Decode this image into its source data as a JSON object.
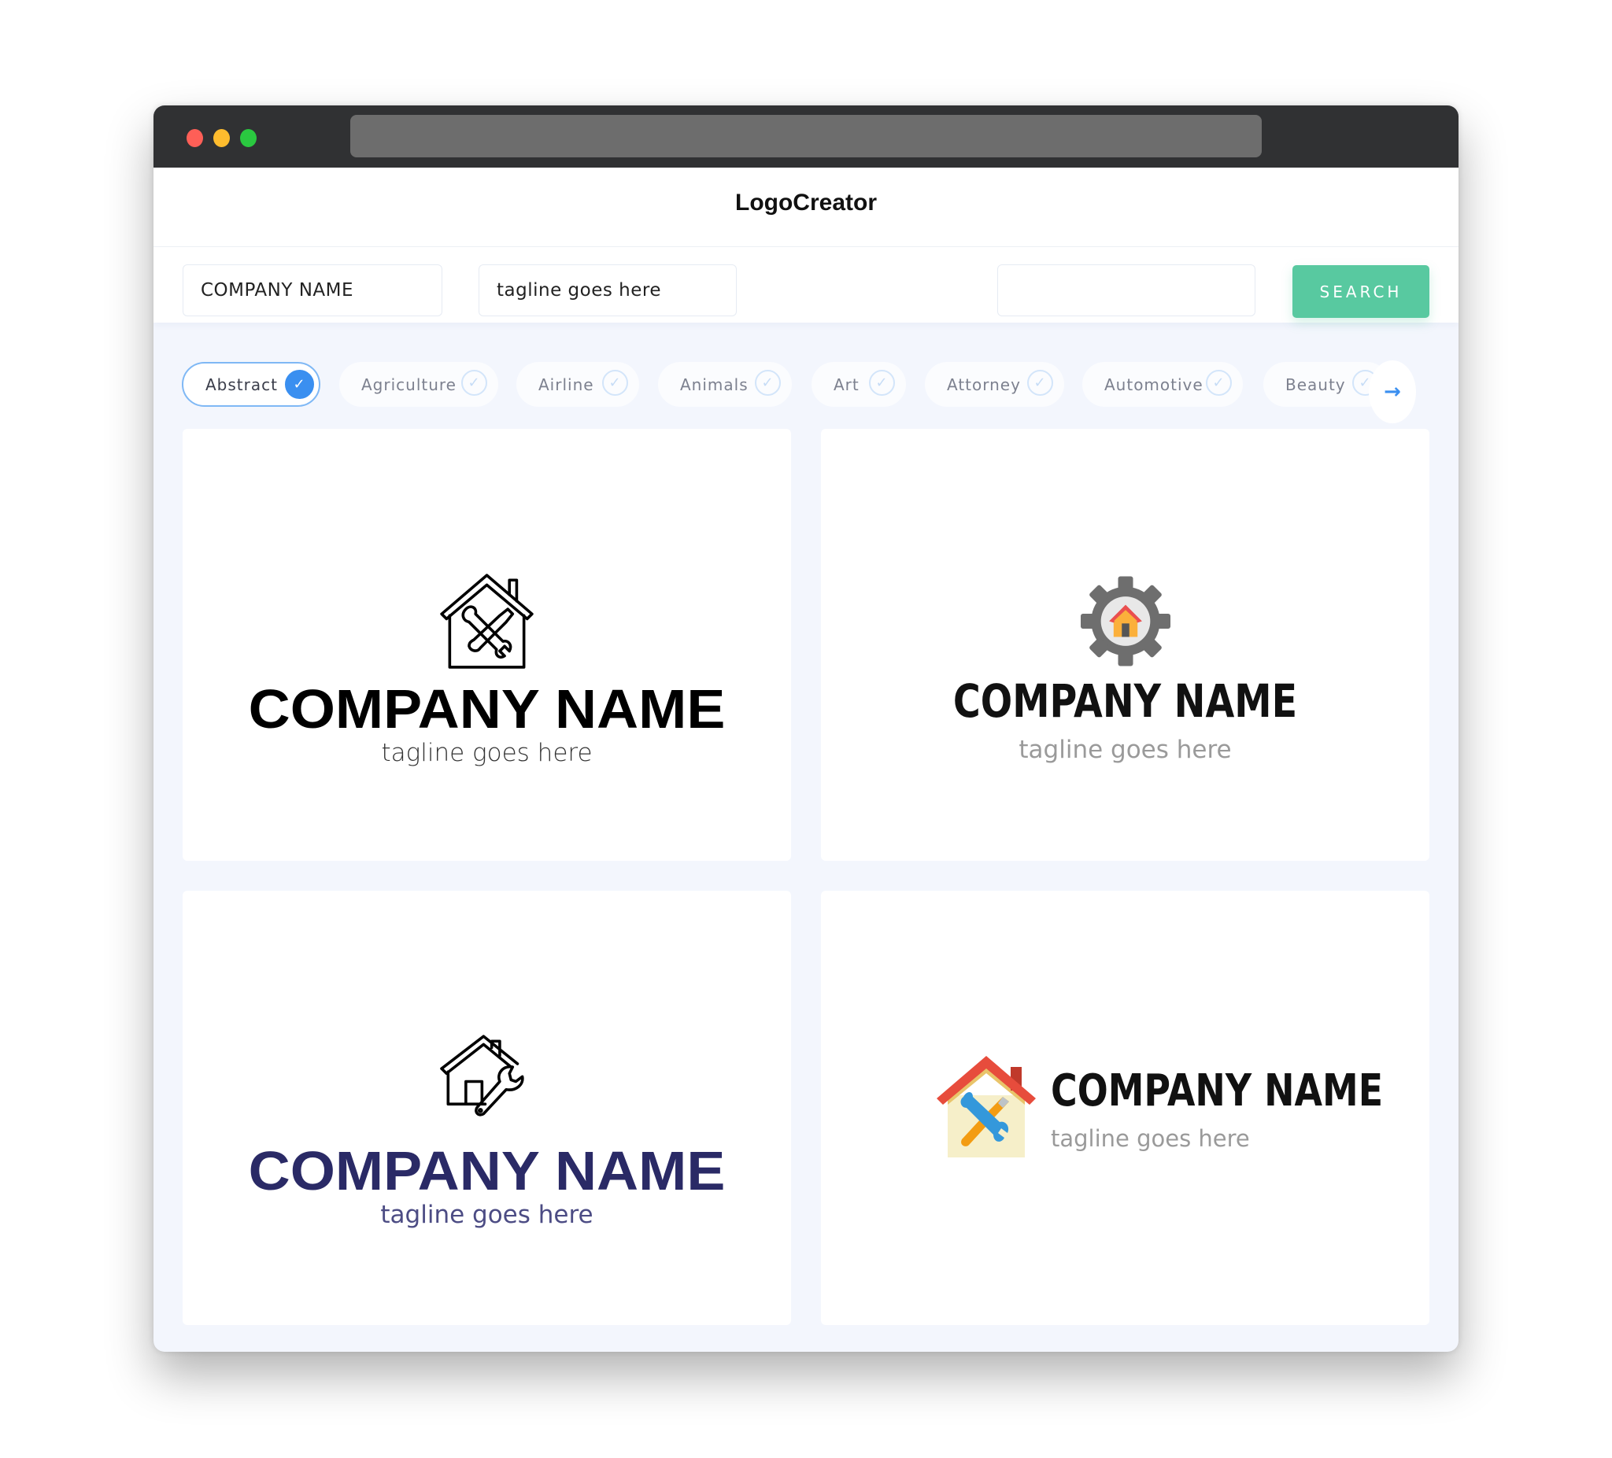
{
  "window": {
    "controls": [
      "close",
      "minimize",
      "maximize"
    ]
  },
  "header": {
    "title": "LogoCreator"
  },
  "search": {
    "company_name_value": "COMPANY NAME",
    "tagline_value": "tagline goes here",
    "extra_value": "",
    "button_label": "SEARCH"
  },
  "categories": {
    "items": [
      {
        "label": "Abstract",
        "selected": true
      },
      {
        "label": "Agriculture",
        "selected": false
      },
      {
        "label": "Airline",
        "selected": false
      },
      {
        "label": "Animals",
        "selected": false
      },
      {
        "label": "Art",
        "selected": false
      },
      {
        "label": "Attorney",
        "selected": false
      },
      {
        "label": "Automotive",
        "selected": false
      },
      {
        "label": "Beauty",
        "selected": false
      }
    ],
    "check_glyph": "✓",
    "next_glyph": "→"
  },
  "logos": [
    {
      "icon": "house-wrench-screwdriver-outline-icon",
      "name": "COMPANY NAME",
      "tagline": "tagline goes here",
      "name_color": "#000000"
    },
    {
      "icon": "gear-house-icon",
      "name": "COMPANY NAME",
      "tagline": "tagline goes here",
      "name_color": "#111111"
    },
    {
      "icon": "house-wrench-outline-icon",
      "name": "COMPANY NAME",
      "tagline": "tagline goes here",
      "name_color": "#2a2a66"
    },
    {
      "icon": "house-tools-color-icon",
      "name": "COMPANY NAME",
      "tagline": "tagline goes here",
      "name_color": "#111111"
    }
  ],
  "colors": {
    "accent_green": "#58c9a0",
    "accent_blue": "#3a8ff0",
    "page_bg": "#f3f6fd",
    "titlebar": "#303133"
  }
}
